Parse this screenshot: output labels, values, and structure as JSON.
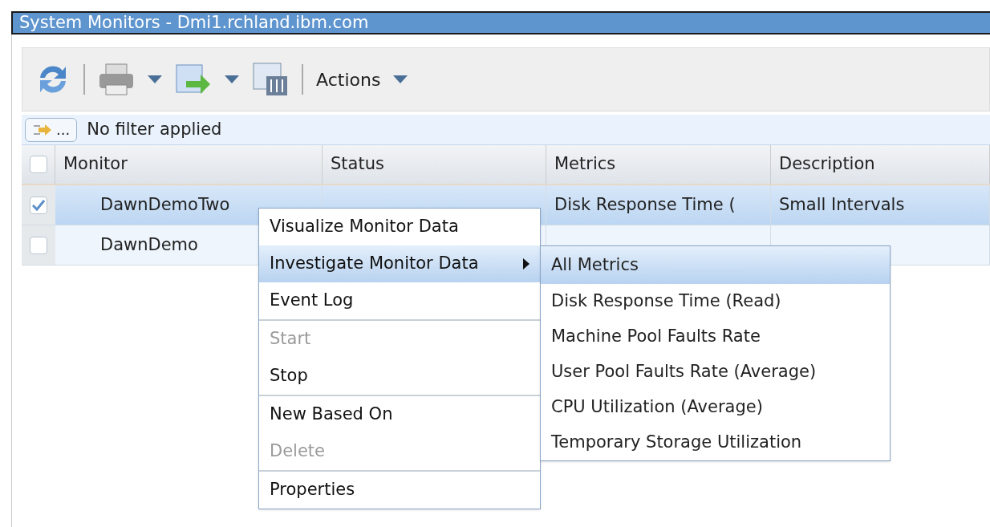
{
  "window": {
    "title": "System Monitors - Dmi1.rchland.ibm.com"
  },
  "toolbar": {
    "actions_label": "Actions"
  },
  "filter": {
    "button_label": "...",
    "text": "No filter applied"
  },
  "table": {
    "select_all": {
      "checked": false
    },
    "columns": [
      "Monitor",
      "Status",
      "Metrics",
      "Description"
    ],
    "rows": [
      {
        "selected": true,
        "checked": true,
        "cells": [
          "DawnDemoTwo",
          "",
          "Disk Response Time (",
          "Small Intervals"
        ]
      },
      {
        "selected": false,
        "checked": false,
        "cells": [
          "DawnDemo",
          "",
          "",
          ""
        ]
      }
    ]
  },
  "context_menu": {
    "groups": [
      [
        {
          "label": "Visualize Monitor Data",
          "disabled": false,
          "selected": false,
          "submenu": false
        },
        {
          "label": "Investigate Monitor Data",
          "disabled": false,
          "selected": true,
          "submenu": true
        },
        {
          "label": "Event Log",
          "disabled": false,
          "selected": false,
          "submenu": false
        }
      ],
      [
        {
          "label": "Start",
          "disabled": true,
          "selected": false,
          "submenu": false
        },
        {
          "label": "Stop",
          "disabled": false,
          "selected": false,
          "submenu": false
        }
      ],
      [
        {
          "label": "New Based On",
          "disabled": false,
          "selected": false,
          "submenu": false
        },
        {
          "label": "Delete",
          "disabled": true,
          "selected": false,
          "submenu": false
        }
      ],
      [
        {
          "label": "Properties",
          "disabled": false,
          "selected": false,
          "submenu": false
        }
      ]
    ]
  },
  "submenu": {
    "items": [
      {
        "label": "All Metrics",
        "selected": true
      },
      {
        "label": "Disk Response Time (Read)",
        "selected": false
      },
      {
        "label": "Machine Pool Faults Rate",
        "selected": false
      },
      {
        "label": "User Pool Faults Rate (Average)",
        "selected": false
      },
      {
        "label": "CPU Utilization (Average)",
        "selected": false
      },
      {
        "label": "Temporary Storage Utilization",
        "selected": false
      }
    ]
  }
}
